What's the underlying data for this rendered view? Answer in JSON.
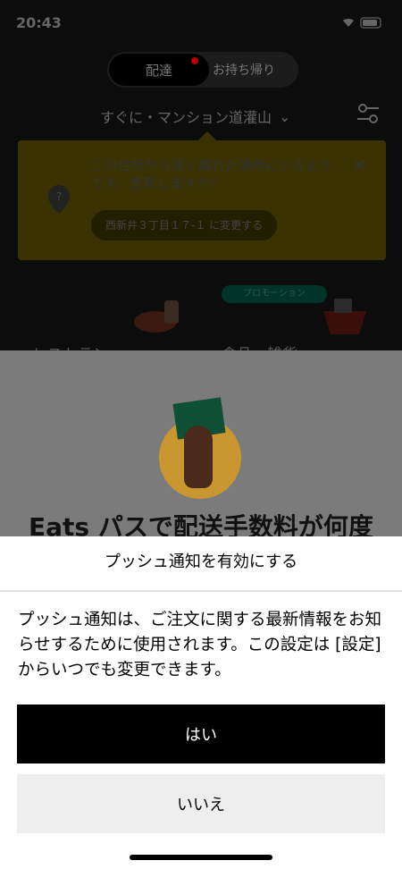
{
  "status_bar": {
    "time": "20:43"
  },
  "top": {
    "mode_delivery": "配達",
    "mode_pickup": "お持ち帰り",
    "address": "すぐに・マンション道灌山"
  },
  "banner": {
    "message": "この住所から遠く離れた場所にいるようです。更新しますか？",
    "action": "西新井３丁目１７-１ に変更する"
  },
  "categories": {
    "promo": "プロモーション",
    "restaurant": "レストラン",
    "grocery": "食品・雑貨"
  },
  "overlay": {
    "heading": "Eats パスで配送手数料が何度"
  },
  "sheet": {
    "title": "プッシュ通知を有効にする",
    "body": "プッシュ通知は、ご注文に関する最新情報をお知らせするために使用されます。この設定は [設定] からいつでも変更できます。",
    "yes": "はい",
    "no": "いいえ"
  },
  "colors": {
    "accent": "#000000",
    "secondary_button": "#eeeeee"
  }
}
